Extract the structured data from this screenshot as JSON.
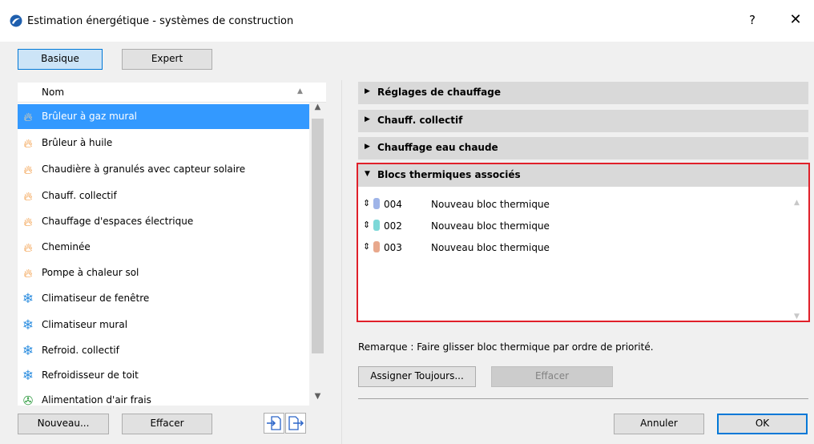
{
  "window": {
    "title": "Estimation énergétique - systèmes de construction",
    "help_label": "?",
    "close_label": "✕"
  },
  "modes": {
    "basic_label": "Basique",
    "expert_label": "Expert",
    "selected": "Basique"
  },
  "list": {
    "column_header": "Nom",
    "items": [
      {
        "label": "Brûleur à gaz mural",
        "icon": "flame-icon",
        "selected": true
      },
      {
        "label": "Brûleur à huile",
        "icon": "flame-icon"
      },
      {
        "label": "Chaudière à granulés avec capteur solaire",
        "icon": "flame-icon"
      },
      {
        "label": "Chauff. collectif",
        "icon": "flame-icon"
      },
      {
        "label": "Chauffage d'espaces électrique",
        "icon": "flame-icon"
      },
      {
        "label": "Cheminée",
        "icon": "flame-icon"
      },
      {
        "label": "Pompe à chaleur sol",
        "icon": "flame-icon"
      },
      {
        "label": "Climatiseur de fenêtre",
        "icon": "snowflake-icon"
      },
      {
        "label": "Climatiseur mural",
        "icon": "snowflake-icon"
      },
      {
        "label": "Refroid. collectif",
        "icon": "snowflake-icon"
      },
      {
        "label": "Refroidisseur de toit",
        "icon": "snowflake-icon"
      },
      {
        "label": "Alimentation d'air frais",
        "icon": "fan-icon"
      }
    ],
    "new_label": "Nouveau...",
    "delete_label": "Effacer"
  },
  "sections": [
    {
      "title": "Réglages de chauffage",
      "expanded": false
    },
    {
      "title": "Chauff. collectif",
      "expanded": false
    },
    {
      "title": "Chauffage eau chaude",
      "expanded": false
    },
    {
      "title": "Blocs thermiques associés",
      "expanded": true
    }
  ],
  "blocks": [
    {
      "number": "004",
      "name": "Nouveau bloc thermique",
      "color": "#9fb4e8"
    },
    {
      "number": "002",
      "name": "Nouveau bloc thermique",
      "color": "#7dd8d8"
    },
    {
      "number": "003",
      "name": "Nouveau bloc thermique",
      "color": "#e8a88c"
    }
  ],
  "remark": "Remarque : Faire glisser bloc thermique par ordre de priorité.",
  "assign_label": "Assigner Toujours...",
  "clear_label": "Effacer",
  "cancel_label": "Annuler",
  "ok_label": "OK",
  "colors": {
    "selection": "#3399ff",
    "highlight_border": "#e0202a",
    "default_button": "#0078d7"
  }
}
